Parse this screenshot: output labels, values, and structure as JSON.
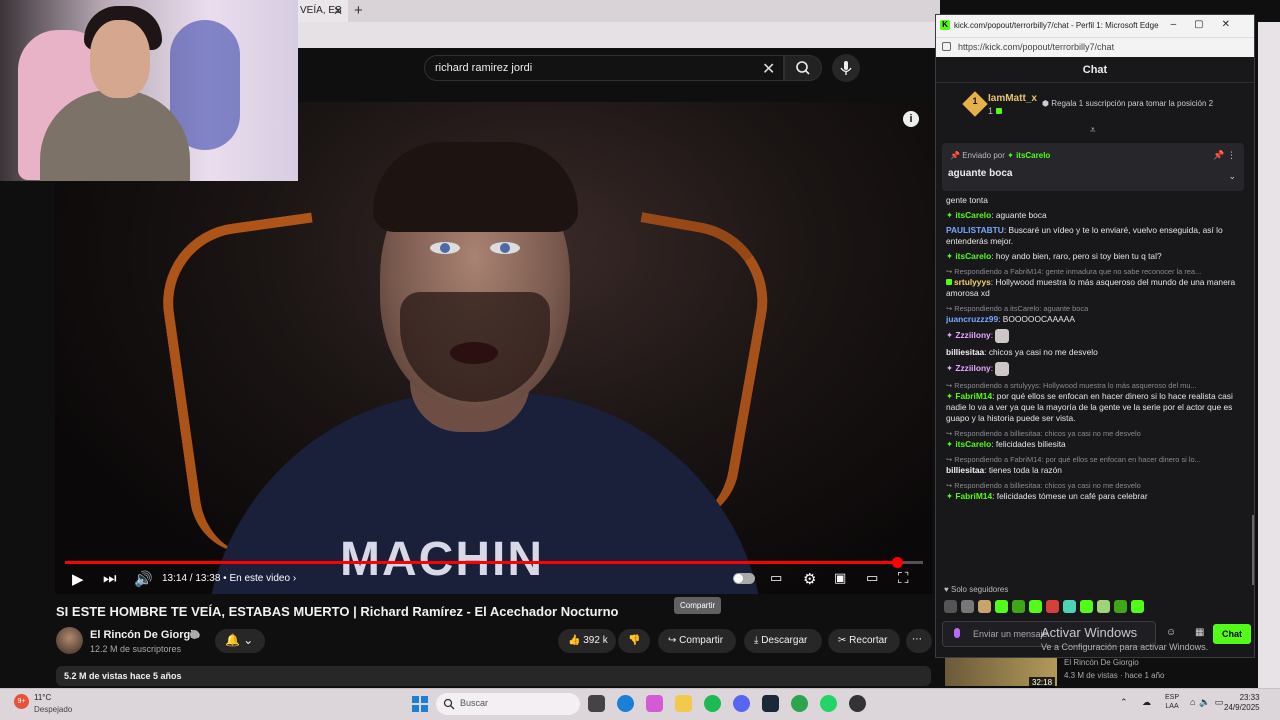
{
  "browser": {
    "tab_title": "VEÍA, ES",
    "tab_close": "✕",
    "new_tab": "+"
  },
  "youtube": {
    "search_value": "richard ramirez jordi",
    "video_title": "SI ESTE HOMBRE TE VEÍA, ESTABAS MUERTO | Richard Ramírez - El Acechador Nocturno",
    "channel": "El Rincón De Giorgio",
    "subscribers": "12.2 M de suscriptores",
    "time": "13:14 / 13:38",
    "live_label": "• En este video",
    "progress": 0.97,
    "likes": "392 k",
    "share": "Compartir",
    "share_tooltip": "Compartir",
    "download": "Descargar",
    "clip": "Recortar",
    "views_line": "5.2 M de vistas   hace 5 años",
    "shirt_text": "MACHIN",
    "more": "⋯",
    "suggestion": {
      "duration": "32:18",
      "channel": "El Rincón De Giorgio",
      "meta": "4.3 M de vistas · hace 1 año"
    }
  },
  "kick": {
    "window_title": "kick.com/popout/terrorbilly7/chat - Perfil 1: Microsoft Edge",
    "url": "https://kick.com/popout/terrorbilly7/chat",
    "header": "Chat",
    "gift_user": "IamMatt_x",
    "gift_count": "1",
    "gift_rank": "1",
    "gift_cta": "Regala 1 suscripción para tomar la posición 2",
    "pinned_label": "Enviado por",
    "pinned_user": "itsCarelo",
    "pinned_message": "aguante boca",
    "followers_only": "Solo seguidores",
    "input_placeholder": "Enviar un mensaje",
    "send_label": "Chat",
    "messages": [
      {
        "reply": "",
        "user": "",
        "text": "gente tonta",
        "color": "none"
      },
      {
        "reply": "",
        "user": "itsCarelo",
        "text": "aguante boca",
        "color": "green"
      },
      {
        "reply": "",
        "user": "PAULISTABTU",
        "text": "Buscaré un vídeo y te lo enviaré, vuelvo enseguida, así lo entenderás mejor.",
        "color": "blue"
      },
      {
        "reply": "",
        "user": "itsCarelo",
        "text": "hoy ando bien, raro, pero si toy bien tu q tal?",
        "color": "green"
      },
      {
        "reply": "Respondiendo a FabriM14: gente inmadura que no sabe reconocer la rea...",
        "user": "srtulyyys",
        "text": "Hollywood muestra lo más asqueroso del mundo de una manera amorosa xd",
        "color": "yellow"
      },
      {
        "reply": "Respondiendo a itsCarelo: aguante boca",
        "user": "juancruzzz99",
        "text": "BOOOOOCAAAAA",
        "color": "blue"
      },
      {
        "reply": "",
        "user": "Zzziilony",
        "text": "",
        "color": "pink"
      },
      {
        "reply": "",
        "user": "billiesitaa",
        "text": "chicos ya casi no me desvelo",
        "color": "white"
      },
      {
        "reply": "",
        "user": "Zzziilony",
        "text": "",
        "color": "pink"
      },
      {
        "reply": "Respondiendo a srtulyyys: Hollywood muestra lo más asqueroso del mu...",
        "user": "FabriM14",
        "text": "por qué ellos se enfocan en hacer dinero si lo hace realista casi nadie lo va a ver ya que la mayoría de la gente ve la serie por el actor que es guapo y la historia puede ser vista.",
        "color": "green"
      },
      {
        "reply": "Respondiendo a billiesitaa: chicos ya casi no me desvelo",
        "user": "itsCarelo",
        "text": "felicidades biliesita",
        "color": "green"
      },
      {
        "reply": "Respondiendo a FabriM14: por qué ellos se enfocan en hacer dinero si lo...",
        "user": "billiesitaa",
        "text": "tienes toda la razón",
        "color": "white"
      },
      {
        "reply": "Respondiendo a billiesitaa: chicos ya casi no me desvelo",
        "user": "FabriM14",
        "text": "felicidades tómese un café para celebrar",
        "color": "green"
      }
    ]
  },
  "windows": {
    "activate_title": "Activar Windows",
    "activate_sub": "Ve a Configuración para activar Windows.",
    "weather_temp": "11°C",
    "weather_desc": "Despejado",
    "weather_badge": "9+",
    "search_placeholder": "Buscar",
    "lang_1": "ESP",
    "lang_2": "LAA",
    "time": "23:33",
    "date": "24/9/2025"
  },
  "colors": {
    "kick_green": "#53fc18",
    "yt_red": "#ff0000"
  }
}
